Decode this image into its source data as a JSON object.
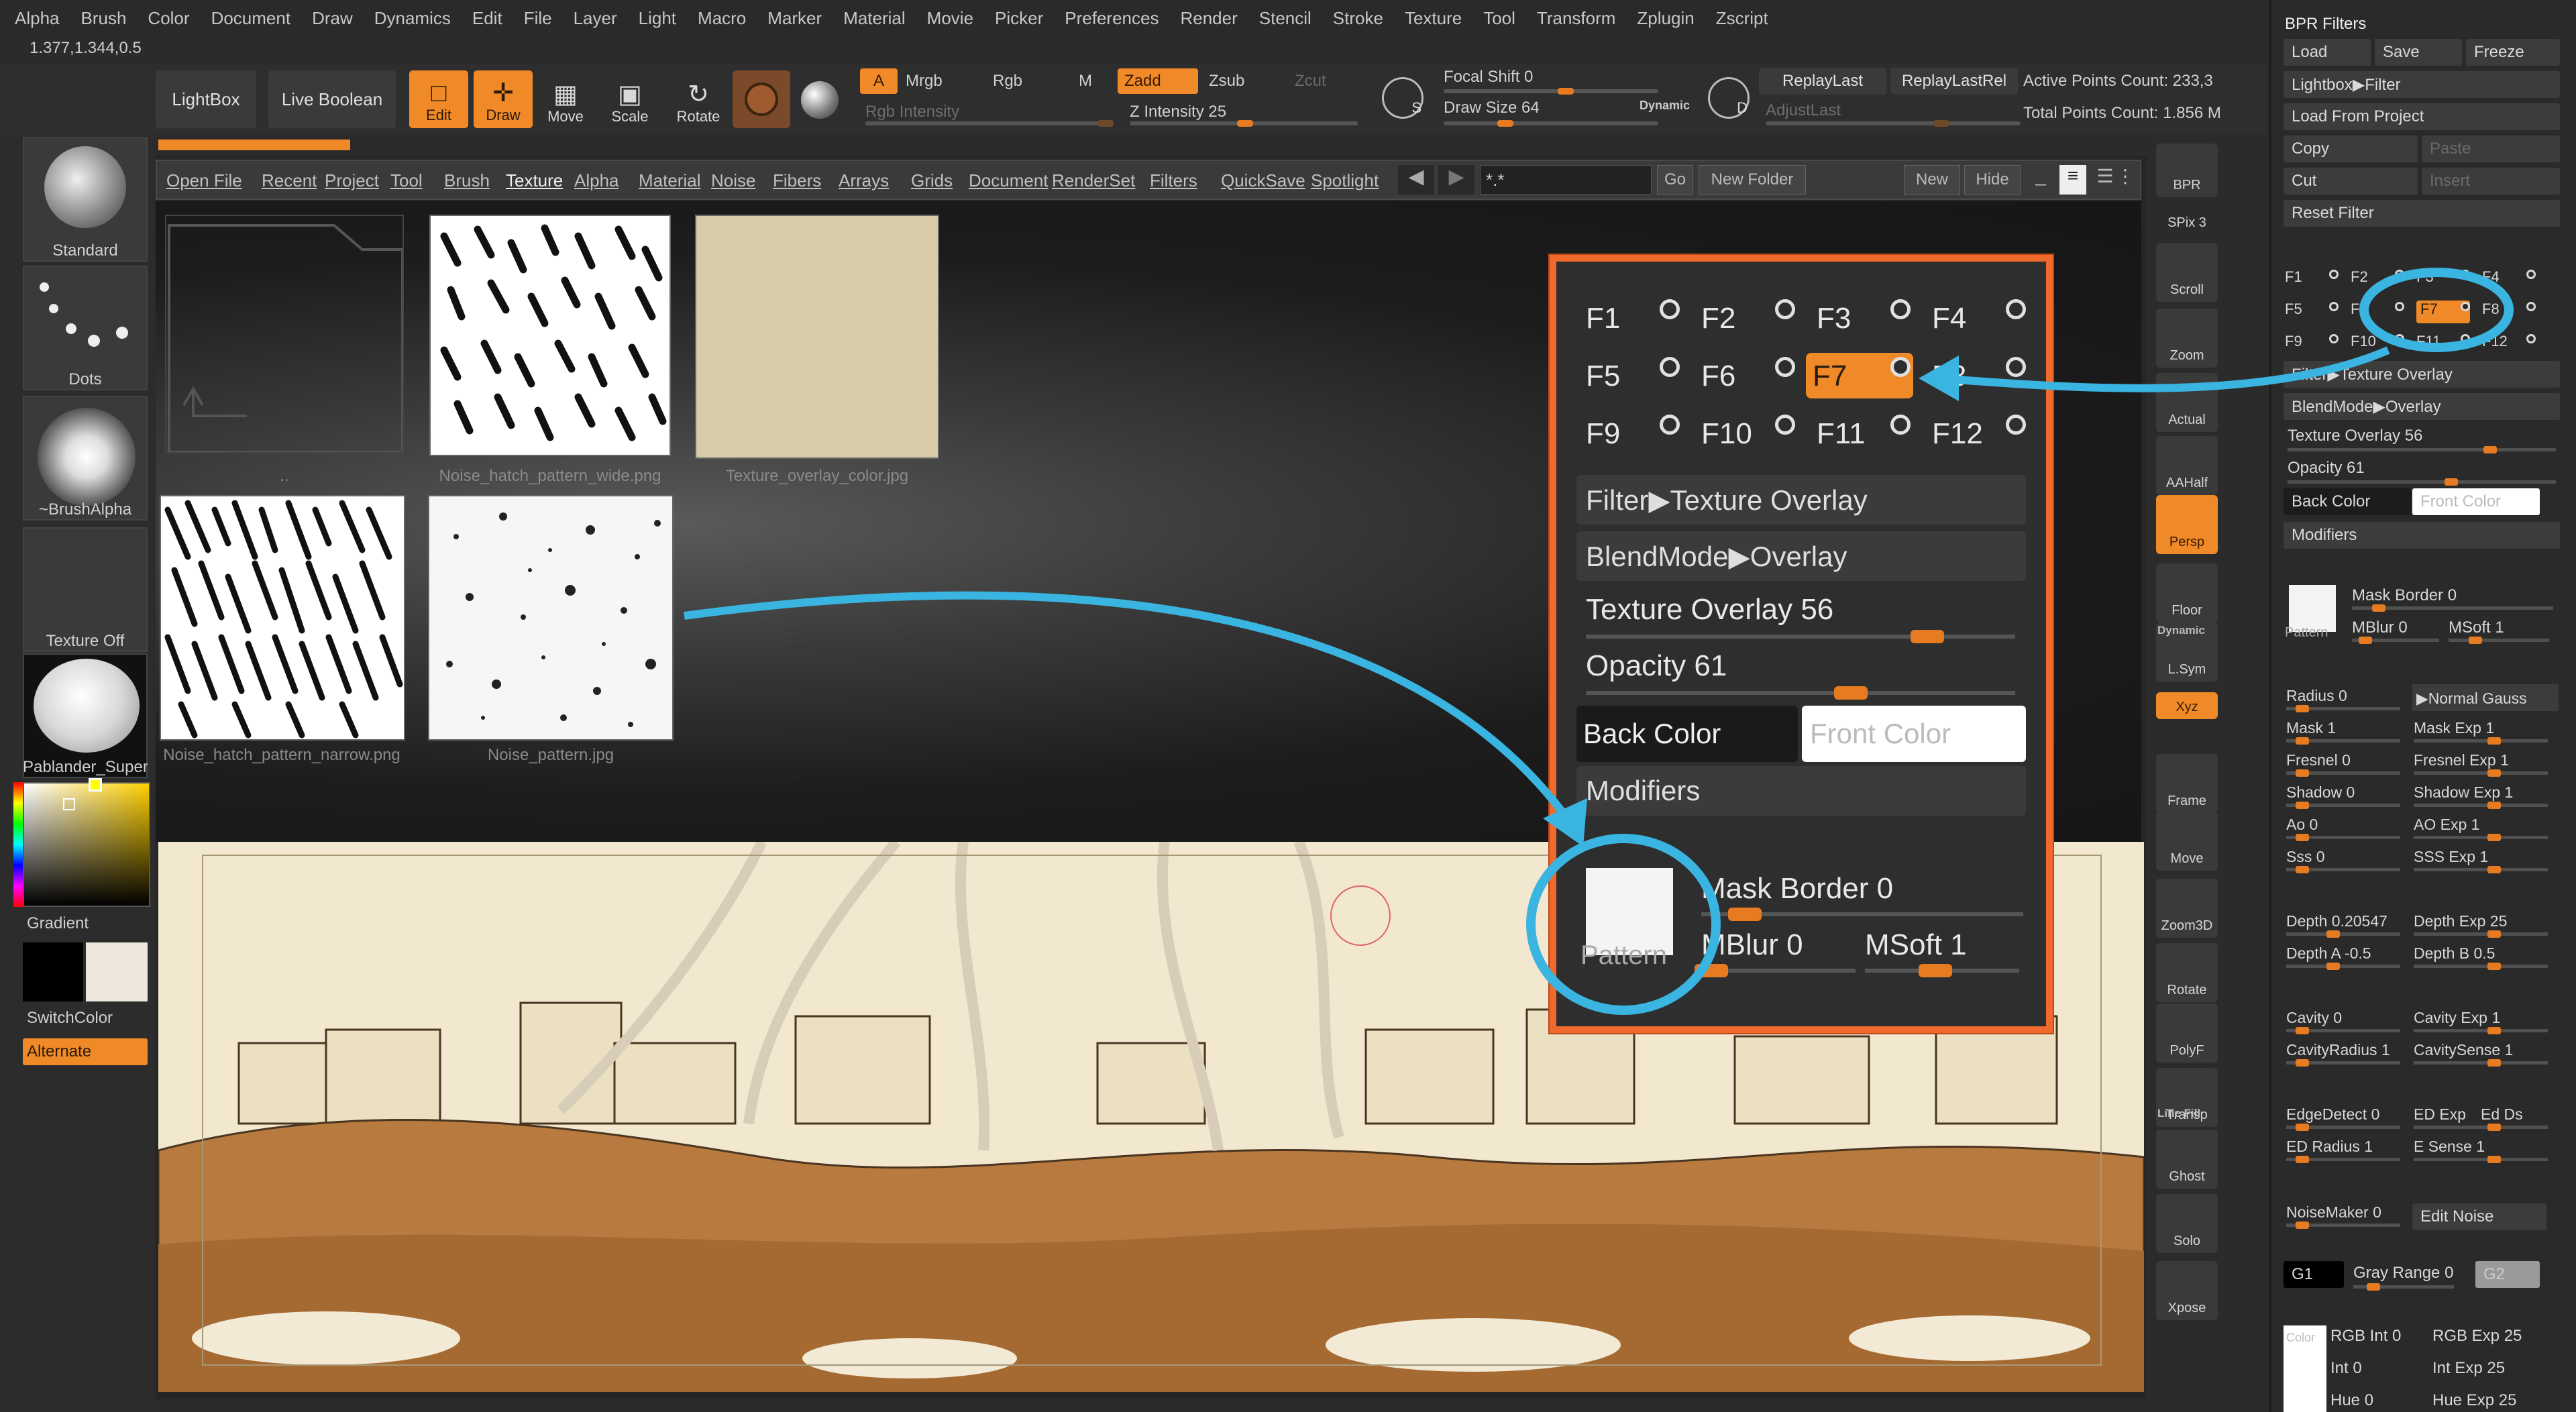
{
  "menu": [
    "Alpha",
    "Brush",
    "Color",
    "Document",
    "Draw",
    "Dynamics",
    "Edit",
    "File",
    "Layer",
    "Light",
    "Macro",
    "Marker",
    "Material",
    "Movie",
    "Picker",
    "Preferences",
    "Render",
    "Stencil",
    "Stroke",
    "Texture",
    "Tool",
    "Transform",
    "Zplugin",
    "Zscript"
  ],
  "coords": "1.377,1.344,0.5",
  "toolbar": {
    "lightbox": "LightBox",
    "live_boolean": "Live Boolean",
    "edit": "Edit",
    "draw": "Draw",
    "move": "Move",
    "scale": "Scale",
    "rotate": "Rotate",
    "a": "A",
    "mrgb": "Mrgb",
    "rgb": "Rgb",
    "m": "M",
    "zadd": "Zadd",
    "zsub": "Zsub",
    "zcut": "Zcut",
    "rgb_intensity": "Rgb Intensity",
    "z_intensity": "Z Intensity 25",
    "focal_shift": "Focal Shift 0",
    "draw_size": "Draw Size 64",
    "dynamic": "Dynamic",
    "replay_last": "ReplayLast",
    "replay_last_rel": "ReplayLastRel",
    "adjust_last": "AdjustLast",
    "active_points": "Active Points Count: 233,3",
    "total_points": "Total Points Count: 1.856 M",
    "s_label": "S",
    "d_label": "D",
    "z_intensity_value": 25,
    "draw_size_value": 64
  },
  "left_tray": {
    "items": [
      {
        "label": "Standard"
      },
      {
        "label": "Dots"
      },
      {
        "label": "~BrushAlpha"
      },
      {
        "label": "Texture Off"
      },
      {
        "label": "Pablander_Super"
      }
    ],
    "gradient": "Gradient",
    "switch_color": "SwitchColor",
    "alternate": "Alternate"
  },
  "lightbox": {
    "tabs": [
      "Open File",
      "Recent",
      "Project",
      "Tool",
      "Brush",
      "Texture",
      "Alpha",
      "Material",
      "Noise",
      "Fibers",
      "Arrays",
      "Grids",
      "Document",
      "RenderSet",
      "Filters",
      "QuickSave",
      "Spotlight"
    ],
    "active_tab": "Texture",
    "search_value": "*.*",
    "go": "Go",
    "new_folder": "New Folder",
    "new": "New",
    "hide": "Hide",
    "thumbs": [
      {
        "label": ".."
      },
      {
        "label": "Noise_hatch_pattern_wide.png"
      },
      {
        "label": "Texture_overlay_color.jpg"
      },
      {
        "label": "Noise_hatch_pattern_narrow.png"
      },
      {
        "label": "Noise_pattern.jpg"
      }
    ]
  },
  "shelf": [
    "BPR",
    "SPix 3",
    "Scroll",
    "Zoom",
    "Actual",
    "AAHalf",
    "Persp",
    "Floor",
    "L.Sym",
    "Xyz",
    "Frame",
    "Move",
    "Zoom3D",
    "Rotate",
    "PolyF",
    "Transp",
    "Ghost",
    "Solo",
    "Xpose"
  ],
  "shelf_extra": {
    "dynamic": "Dynamic",
    "line_fill": "Line Fill"
  },
  "bpr": {
    "title": "BPR Filters",
    "load": "Load",
    "save": "Save",
    "freeze": "Freeze",
    "lightbox_filter": "Lightbox▶Filter",
    "load_from_project": "Load From Project",
    "copy": "Copy",
    "paste": "Paste",
    "cut": "Cut",
    "insert": "Insert",
    "reset_filter": "Reset Filter",
    "slots": [
      "F1",
      "F2",
      "F3",
      "F4",
      "F5",
      "F6",
      "F7",
      "F8",
      "F9",
      "F10",
      "F11",
      "F12"
    ],
    "active_slot": "F7",
    "filter": "Filter▶Texture Overlay",
    "blendmode": "BlendMode▶Overlay",
    "texture_overlay": "Texture Overlay 56",
    "opacity": "Opacity 61",
    "back_color": "Back Color",
    "front_color": "Front Color",
    "modifiers": "Modifiers",
    "mask_border": "Mask Border 0",
    "mblur": "MBlur 0",
    "msoft": "MSoft 1",
    "pattern": "Pattern",
    "radius": "Radius 0",
    "normal_gauss": "▶Normal Gauss",
    "mask": "Mask 1",
    "mask_exp": "Mask Exp 1",
    "fresnel": "Fresnel 0",
    "fresnel_exp": "Fresnel Exp 1",
    "shadow": "Shadow 0",
    "shadow_exp": "Shadow Exp 1",
    "ao": "Ao 0",
    "ao_exp": "AO Exp 1",
    "sss": "Sss 0",
    "sss_exp": "SSS Exp 1",
    "depth": "Depth 0.20547",
    "depth_exp": "Depth Exp 25",
    "depth_a": "Depth A -0.5",
    "depth_b": "Depth B 0.5",
    "cavity": "Cavity 0",
    "cavity_exp": "Cavity Exp 1",
    "cavity_radius": "CavityRadius 1",
    "cavity_sense": "CavitySense 1",
    "edge_detect": "EdgeDetect 0",
    "ed_exp": "ED Exp",
    "ed_ds": "Ed Ds",
    "ed_radius": "ED Radius 1",
    "e_sense": "E Sense 1",
    "noise_maker": "NoiseMaker 0",
    "edit_noise": "Edit Noise",
    "g1": "G1",
    "gray_range": "Gray Range 0",
    "g2": "G2",
    "color": "Color",
    "rgb_int": "RGB Int 0",
    "rgb_exp": "RGB Exp 25",
    "int": "Int 0",
    "int_exp": "Int Exp 25",
    "hue": "Hue 0",
    "hue_exp": "Hue Exp 25",
    "texture_overlay_value": 56,
    "opacity_value": 61
  },
  "colors": {
    "accent": "#f08a28",
    "callout": "#3ab4e0",
    "zoom_border": "#ef6a2c"
  }
}
